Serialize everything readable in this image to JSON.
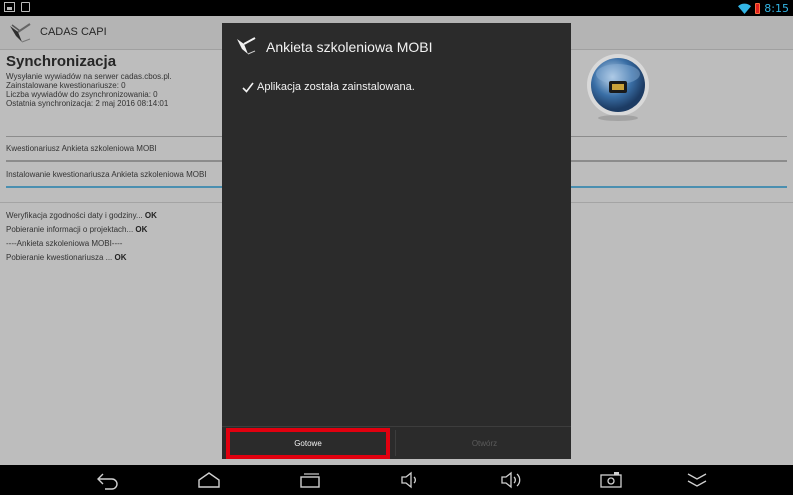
{
  "status_bar": {
    "time": "8:15",
    "icons": [
      "picture-icon",
      "bag-icon",
      "wifi-icon",
      "battery-icon"
    ],
    "time_color": "#33b5e5",
    "battery_color": "#e02020"
  },
  "app": {
    "title": "CADAS CAPI",
    "sync_title": "Synchronizacja",
    "sync_lines": [
      "Wysyłanie wywiadów na serwer cadas.cbos.pl.",
      "Zainstalowane kwestionariusze: 0",
      "Liczba wywiadów do zsynchronizowania: 0",
      "Ostatnia synchronizacja: 2 maj 2016 08:14:01"
    ],
    "questionnaire": "Kwestionariusz Ankieta szkoleniowa MOBI",
    "installing": "Instalowanie kwestionariusza Ankieta szkoleniowa MOBI",
    "log": [
      {
        "text": "Weryfikacja zgodności daty i godziny... ",
        "status": "OK"
      },
      {
        "text": "Pobieranie informacji o projektach... ",
        "status": "OK"
      },
      {
        "text": "----Ankieta szkoleniowa MOBI----",
        "status": ""
      },
      {
        "text": "Pobieranie kwestionariusza ... ",
        "status": "OK"
      }
    ]
  },
  "dialog": {
    "title": "Ankieta szkoleniowa MOBI",
    "message": "Aplikacja została zainstalowana.",
    "done_label": "Gotowe",
    "open_label": "Otwórz",
    "highlight_color": "#e1000f"
  },
  "nav_bar": {
    "buttons": [
      "back-icon",
      "home-icon",
      "recent-apps-icon",
      "volume-down-icon",
      "volume-up-icon",
      "screenshot-icon",
      "hide-keyboard-icon"
    ]
  }
}
